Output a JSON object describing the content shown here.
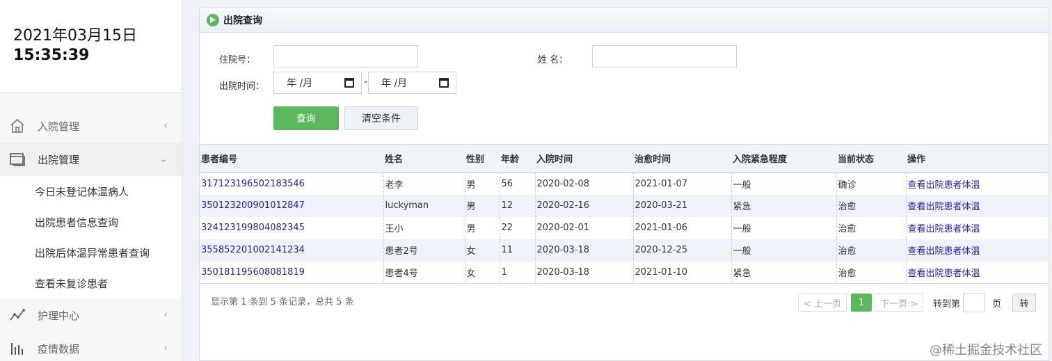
{
  "clock": {
    "date": "2021年03月15日",
    "time": "15:35:39"
  },
  "sidebar": {
    "menus": [
      {
        "label": "入院管理",
        "icon": "home-icon"
      },
      {
        "label": "出院管理",
        "icon": "window-icon",
        "sub": [
          "今日未登记体温病人",
          "出院患者信息查询",
          "出院后体温异常患者查询",
          "查看未复诊患者"
        ]
      },
      {
        "label": "护理中心",
        "icon": "line-chart-icon"
      },
      {
        "label": "疫情数据",
        "icon": "bar-chart-icon"
      }
    ]
  },
  "panel": {
    "title": "出院查询"
  },
  "form": {
    "admission_no_label": "住院号：",
    "name_label": "姓 名：",
    "discharge_time_label": "出院时间：",
    "date_from": "年 /月",
    "date_to": "年 /月",
    "range_sep": "-",
    "query_btn": "查询",
    "clear_btn": "清空条件"
  },
  "table": {
    "headers": [
      "患者编号",
      "姓名",
      "性别",
      "年龄",
      "入院时间",
      "治愈时间",
      "入院紧急程度",
      "当前状态",
      "操作"
    ],
    "rows": [
      [
        "317123196502183546",
        "老李",
        "男",
        "56",
        "2020-02-08",
        "2021-01-07",
        "一般",
        "确诊",
        "查看出院患者体温"
      ],
      [
        "350123200901012847",
        "luckyman",
        "男",
        "12",
        "2020-02-16",
        "2020-03-21",
        "紧急",
        "治愈",
        "查看出院患者体温"
      ],
      [
        "324123199804082345",
        "王小",
        "男",
        "22",
        "2020-02-01",
        "2021-01-06",
        "一般",
        "治愈",
        "查看出院患者体温"
      ],
      [
        "355852201002141234",
        "患者2号",
        "女",
        "11",
        "2020-03-18",
        "2020-12-25",
        "一般",
        "治愈",
        "查看出院患者体温"
      ],
      [
        "350181195608081819",
        "患者4号",
        "女",
        "1",
        "2020-03-18",
        "2021-01-10",
        "紧急",
        "治愈",
        "查看出院患者体温"
      ]
    ]
  },
  "pagination": {
    "info": "显示第 1 条到 5 条记录，总共 5 条",
    "prev": "< 上一页",
    "current": "1",
    "next": "下一页 >",
    "goto_label": "转到第",
    "page_unit": "页",
    "go_btn": "转"
  },
  "watermark": "@稀土掘金技术社区",
  "colors": {
    "accent": "#5cb85c",
    "link": "#2222aa"
  }
}
